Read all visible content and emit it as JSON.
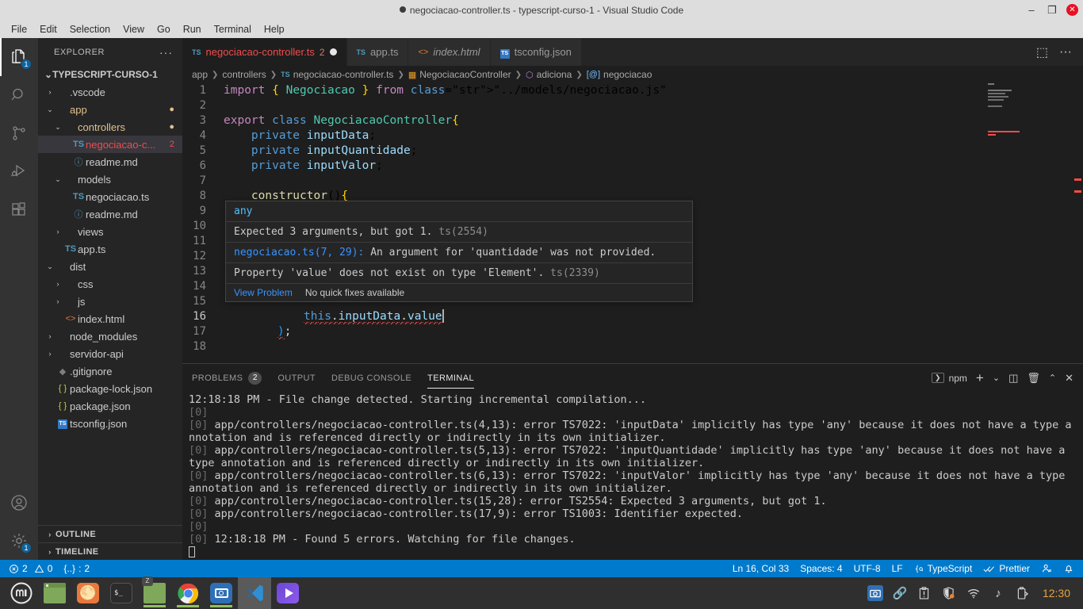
{
  "window": {
    "title": "negociacao-controller.ts - typescript-curso-1 - Visual Studio Code",
    "minimize_label": "–",
    "maximize_label": "❐",
    "close_label": "✕"
  },
  "menubar": {
    "items": [
      "File",
      "Edit",
      "Selection",
      "View",
      "Go",
      "Run",
      "Terminal",
      "Help"
    ]
  },
  "activitybar": {
    "items": [
      {
        "name": "explorer",
        "icon": "files-icon",
        "badge": "1",
        "active": true
      },
      {
        "name": "search",
        "icon": "search-icon",
        "badge": "",
        "active": false
      },
      {
        "name": "source-control",
        "icon": "source-control-icon",
        "badge": "",
        "active": false
      },
      {
        "name": "run-debug",
        "icon": "run-debug-icon",
        "badge": "",
        "active": false
      },
      {
        "name": "extensions",
        "icon": "extensions-icon",
        "badge": "",
        "active": false
      }
    ],
    "bottom": [
      {
        "name": "accounts",
        "icon": "account-icon",
        "badge": ""
      },
      {
        "name": "settings",
        "icon": "gear-icon",
        "badge": "1"
      }
    ]
  },
  "sidebar": {
    "header_title": "EXPLORER",
    "header_more": "···",
    "root_label": "TYPESCRIPT-CURSO-1",
    "tree": [
      {
        "label": ".vscode",
        "indent": 1,
        "chev": "›",
        "icon": "",
        "tail": "",
        "selected": false,
        "state": ""
      },
      {
        "label": "app",
        "indent": 1,
        "chev": "⌄",
        "icon": "",
        "tail": "●",
        "selected": false,
        "state": "mod"
      },
      {
        "label": "controllers",
        "indent": 2,
        "chev": "⌄",
        "icon": "",
        "tail": "●",
        "selected": false,
        "state": "mod"
      },
      {
        "label": "negociacao-c...",
        "indent": 3,
        "chev": "",
        "icon": "ts",
        "tail": "2",
        "selected": true,
        "state": "err"
      },
      {
        "label": "readme.md",
        "indent": 3,
        "chev": "",
        "icon": "md",
        "tail": "",
        "selected": false,
        "state": ""
      },
      {
        "label": "models",
        "indent": 2,
        "chev": "⌄",
        "icon": "",
        "tail": "",
        "selected": false,
        "state": ""
      },
      {
        "label": "negociacao.ts",
        "indent": 3,
        "chev": "",
        "icon": "ts",
        "tail": "",
        "selected": false,
        "state": ""
      },
      {
        "label": "readme.md",
        "indent": 3,
        "chev": "",
        "icon": "md",
        "tail": "",
        "selected": false,
        "state": ""
      },
      {
        "label": "views",
        "indent": 2,
        "chev": "›",
        "icon": "",
        "tail": "",
        "selected": false,
        "state": ""
      },
      {
        "label": "app.ts",
        "indent": 2,
        "chev": "",
        "icon": "ts",
        "tail": "",
        "selected": false,
        "state": ""
      },
      {
        "label": "dist",
        "indent": 1,
        "chev": "⌄",
        "icon": "",
        "tail": "",
        "selected": false,
        "state": ""
      },
      {
        "label": "css",
        "indent": 2,
        "chev": "›",
        "icon": "",
        "tail": "",
        "selected": false,
        "state": ""
      },
      {
        "label": "js",
        "indent": 2,
        "chev": "›",
        "icon": "",
        "tail": "",
        "selected": false,
        "state": ""
      },
      {
        "label": "index.html",
        "indent": 2,
        "chev": "",
        "icon": "html",
        "tail": "",
        "selected": false,
        "state": ""
      },
      {
        "label": "node_modules",
        "indent": 1,
        "chev": "›",
        "icon": "",
        "tail": "",
        "selected": false,
        "state": ""
      },
      {
        "label": "servidor-api",
        "indent": 1,
        "chev": "›",
        "icon": "",
        "tail": "",
        "selected": false,
        "state": ""
      },
      {
        "label": ".gitignore",
        "indent": 1,
        "chev": "",
        "icon": "git",
        "tail": "",
        "selected": false,
        "state": ""
      },
      {
        "label": "package-lock.json",
        "indent": 1,
        "chev": "",
        "icon": "json",
        "tail": "",
        "selected": false,
        "state": ""
      },
      {
        "label": "package.json",
        "indent": 1,
        "chev": "",
        "icon": "json",
        "tail": "",
        "selected": false,
        "state": ""
      },
      {
        "label": "tsconfig.json",
        "indent": 1,
        "chev": "",
        "icon": "tsconf",
        "tail": "",
        "selected": false,
        "state": ""
      }
    ],
    "sections": [
      {
        "label": "OUTLINE",
        "chev": "›"
      },
      {
        "label": "TIMELINE",
        "chev": "›"
      }
    ]
  },
  "tabs": {
    "items": [
      {
        "label": "negociacao-controller.ts",
        "icon": "ts",
        "badge": "2",
        "dirty": true,
        "active": true,
        "error": true,
        "italic": false
      },
      {
        "label": "app.ts",
        "icon": "ts",
        "badge": "",
        "dirty": false,
        "active": false,
        "error": false,
        "italic": false
      },
      {
        "label": "index.html",
        "icon": "html",
        "badge": "",
        "dirty": false,
        "active": false,
        "error": false,
        "italic": true
      },
      {
        "label": "tsconfig.json",
        "icon": "tsconf",
        "badge": "",
        "dirty": false,
        "active": false,
        "error": false,
        "italic": false
      }
    ],
    "split_editor_label": "⬚",
    "more_actions_label": "···"
  },
  "breadcrumb": [
    {
      "label": "app",
      "icon": ""
    },
    {
      "label": "controllers",
      "icon": ""
    },
    {
      "label": "negociacao-controller.ts",
      "icon": "ts"
    },
    {
      "label": "NegociacaoController",
      "icon": "class"
    },
    {
      "label": "adiciona",
      "icon": "method"
    },
    {
      "label": "negociacao",
      "icon": "variable"
    }
  ],
  "editor": {
    "lines": [
      {
        "n": 1,
        "text": "import { Negociacao } from \"../models/negociacao.js\";"
      },
      {
        "n": 2,
        "text": ""
      },
      {
        "n": 3,
        "text": "export class NegociacaoController{"
      },
      {
        "n": 4,
        "text": "    private inputData;"
      },
      {
        "n": 5,
        "text": "    private inputQuantidade;"
      },
      {
        "n": 6,
        "text": "    private inputValor;"
      },
      {
        "n": 7,
        "text": ""
      },
      {
        "n": 8,
        "text": "    constructor(){"
      },
      {
        "n": 9,
        "text": ""
      },
      {
        "n": 10,
        "text": ""
      },
      {
        "n": 11,
        "text": ""
      },
      {
        "n": 12,
        "text": ""
      },
      {
        "n": 13,
        "text": ""
      },
      {
        "n": 14,
        "text": ""
      },
      {
        "n": 15,
        "text": ""
      },
      {
        "n": 16,
        "text": "            this.inputData.value"
      },
      {
        "n": 17,
        "text": "        );"
      },
      {
        "n": 18,
        "text": ""
      }
    ]
  },
  "hover": {
    "type_line": "any",
    "rows": [
      {
        "text": "Expected 3 arguments, but got 1.",
        "code": "ts(2554)"
      },
      {
        "link": "negociacao.ts(7, 29):",
        "text": "An argument for 'quantidade' was not provided."
      },
      {
        "text": "Property 'value' does not exist on type 'Element'.",
        "code": "ts(2339)"
      }
    ],
    "action_link": "View Problem",
    "action_dim": "No quick fixes available"
  },
  "panel": {
    "tabs": [
      {
        "label": "PROBLEMS",
        "badge": "2",
        "active": false
      },
      {
        "label": "OUTPUT",
        "badge": "",
        "active": false
      },
      {
        "label": "DEBUG CONSOLE",
        "badge": "",
        "active": false
      },
      {
        "label": "TERMINAL",
        "badge": "",
        "active": true
      }
    ],
    "shell_label": "npm",
    "shell_icon": "terminal-chevron-icon",
    "actions": {
      "new_terminal": "+",
      "dropdown": "⌄",
      "split": "◫",
      "kill": "🗑",
      "maximize": "⌃",
      "close": "✕"
    },
    "terminal_lines": [
      {
        "pid": "",
        "text": "12:18:18 PM - File change detected. Starting incremental compilation..."
      },
      {
        "pid": "[0]",
        "text": ""
      },
      {
        "pid": "[0]",
        "text": "app/controllers/negociacao-controller.ts(4,13): error TS7022: 'inputData' implicitly has type 'any' because it does not have a type annotation and is referenced directly or indirectly in its own initializer."
      },
      {
        "pid": "[0]",
        "text": "app/controllers/negociacao-controller.ts(5,13): error TS7022: 'inputQuantidade' implicitly has type 'any' because it does not have a type annotation and is referenced directly or indirectly in its own initializer."
      },
      {
        "pid": "[0]",
        "text": "app/controllers/negociacao-controller.ts(6,13): error TS7022: 'inputValor' implicitly has type 'any' because it does not have a type annotation and is referenced directly or indirectly in its own initializer."
      },
      {
        "pid": "[0]",
        "text": "app/controllers/negociacao-controller.ts(15,28): error TS2554: Expected 3 arguments, but got 1."
      },
      {
        "pid": "[0]",
        "text": "app/controllers/negociacao-controller.ts(17,9): error TS1003: Identifier expected."
      },
      {
        "pid": "[0]",
        "text": ""
      },
      {
        "pid": "[0]",
        "text": "12:18:18 PM - Found 5 errors. Watching for file changes."
      }
    ]
  },
  "statusbar": {
    "errors": "2",
    "warnings": "0",
    "ports": "2",
    "ports_icon": "{..}",
    "position": "Ln 16, Col 33",
    "spaces": "Spaces: 4",
    "encoding": "UTF-8",
    "eol": "LF",
    "language": "TypeScript",
    "prettier": "Prettier",
    "accent": "#007acc"
  },
  "taskbar": {
    "apps": [
      {
        "name": "mint-menu-button",
        "color": "#3a3a3a"
      },
      {
        "name": "file-manager",
        "color": "#7fa85a"
      },
      {
        "name": "firefox",
        "color": "#e8783c"
      },
      {
        "name": "terminal",
        "color": "#2b2b2b"
      },
      {
        "name": "files-window",
        "color": "#7fa85a"
      },
      {
        "name": "google-chrome",
        "color": "#ffffff"
      },
      {
        "name": "screenshot-tool",
        "color": "#2f6fb5"
      },
      {
        "name": "visual-studio-code",
        "color": "#2f6fb5"
      },
      {
        "name": "media-player",
        "color": "#6b47d6"
      }
    ],
    "tray": [
      "screenshot-icon",
      "bluetooth-icon",
      "clipboard-icon",
      "shield-icon",
      "wifi-icon",
      "music-icon",
      "battery-icon"
    ],
    "clock": "12:30"
  }
}
